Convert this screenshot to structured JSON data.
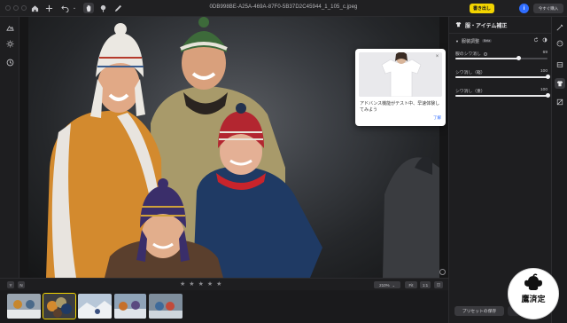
{
  "window": {
    "title": "0DB998BE-A25A-469A-87F0-5B37D2C45944_1_105_c.jpeg",
    "traffic_lights": [
      "close",
      "minimize",
      "zoom"
    ]
  },
  "toolbar": {
    "export_label": "書き出し",
    "info_label": "i",
    "buy_label": "今すぐ購入",
    "icons": [
      "home-icon",
      "plus-icon",
      "undo-icon",
      "hand-icon",
      "magic-brush-icon",
      "brush-icon"
    ]
  },
  "left_tools": [
    "adjust-icon",
    "sun-icon",
    "history-icon"
  ],
  "promo": {
    "text": "アドバンス機能がテスト中、早速体験してみよう",
    "link": "了解",
    "close": "×"
  },
  "panel": {
    "title": "服・アイテム補正",
    "section": "服装調整",
    "beta_badge": "Beta",
    "sliders": [
      {
        "label": "服のシワ消し",
        "value": "69",
        "level": 0.69,
        "has_info": true
      },
      {
        "label": "シワ消し（軽）",
        "value": "100",
        "level": 1.0
      },
      {
        "label": "シワ消し（重）",
        "value": "100",
        "level": 1.0
      }
    ],
    "preset_button": "プリセットの保存",
    "apply_button": "適用"
  },
  "right_rail": [
    "wand-icon",
    "face-icon",
    "layers-icon",
    "shirt-icon",
    "ai-icon"
  ],
  "strip": {
    "view_buttons": [
      "Y",
      "N"
    ],
    "rating_stars": [
      "★",
      "★",
      "★",
      "★",
      "★"
    ],
    "zoom": "210%",
    "fit_label": "Fit",
    "one_to_one": "1:1"
  },
  "watermark": {
    "text": "鷹済定"
  }
}
